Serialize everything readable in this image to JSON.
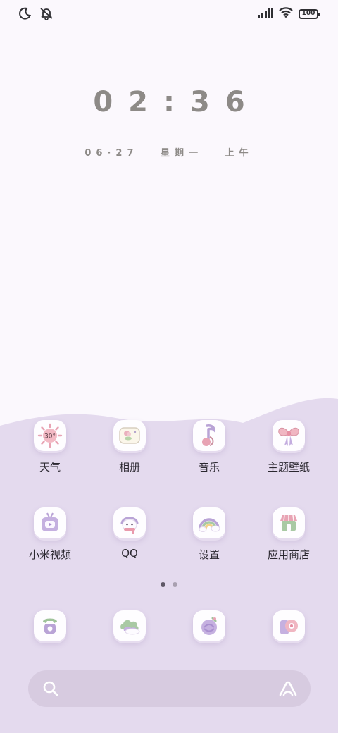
{
  "status_bar": {
    "left_icons": [
      "moon-icon",
      "bell-muted-icon"
    ],
    "right_icons": [
      "signal-icon",
      "wifi-icon",
      "battery-icon"
    ],
    "battery_level": "100"
  },
  "clock": {
    "time": "02:36",
    "date": "06·27",
    "weekday": "星期一",
    "period": "上午"
  },
  "home": {
    "apps": [
      {
        "label": "天气",
        "icon": "weather-sun-icon",
        "badge": "30°"
      },
      {
        "label": "相册",
        "icon": "gallery-icon"
      },
      {
        "label": "音乐",
        "icon": "music-note-icon"
      },
      {
        "label": "主题壁纸",
        "icon": "theme-bow-icon"
      },
      {
        "label": "小米视频",
        "icon": "tv-video-icon"
      },
      {
        "label": "QQ",
        "icon": "qq-penguin-icon"
      },
      {
        "label": "设置",
        "icon": "settings-rainbow-icon"
      },
      {
        "label": "应用商店",
        "icon": "app-store-icon"
      }
    ],
    "pages": {
      "count": 2,
      "current": 1
    }
  },
  "dock": {
    "apps": [
      {
        "icon": "phone-icon"
      },
      {
        "icon": "messages-cloud-icon"
      },
      {
        "icon": "browser-icon"
      },
      {
        "icon": "camera-icon"
      }
    ]
  },
  "search": {
    "icons": [
      "search-icon",
      "assistant-icon"
    ]
  },
  "colors": {
    "background_top": "#fbf8fd",
    "background_lilac": "#e4daee",
    "search_bar": "#d7cbe0",
    "clock_text": "#8d8a87",
    "icon_accent_pink": "#e8a3b4",
    "icon_accent_purple": "#b9a3d6",
    "icon_accent_green": "#a9c9a4"
  }
}
